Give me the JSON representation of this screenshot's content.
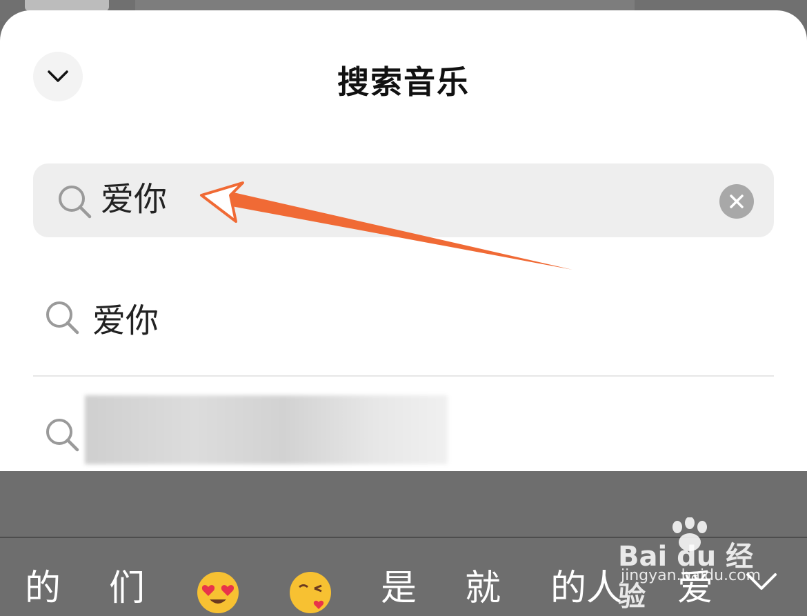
{
  "header": {
    "title": "搜索音乐"
  },
  "search": {
    "value": "爱你"
  },
  "suggestions": [
    {
      "text": "爱你"
    },
    {
      "text": ""
    }
  ],
  "keyboard": {
    "candidates": [
      "的",
      "们",
      "是",
      "就",
      "的人",
      "爱"
    ],
    "emojis": [
      "heart-eyes-emoji",
      "kissing-emoji"
    ]
  },
  "watermark": {
    "logo": "Bai du 经验",
    "url": "jingyan.baidu.com"
  },
  "colors": {
    "arrow": "#f06a35",
    "sheet": "#ffffff",
    "search_bg": "#eeeeee",
    "keyboard_bg": "#6e6e6e"
  },
  "icons": [
    "chevron-down-icon",
    "search-icon",
    "clear-icon",
    "keyboard-collapse-icon",
    "paw-icon"
  ]
}
